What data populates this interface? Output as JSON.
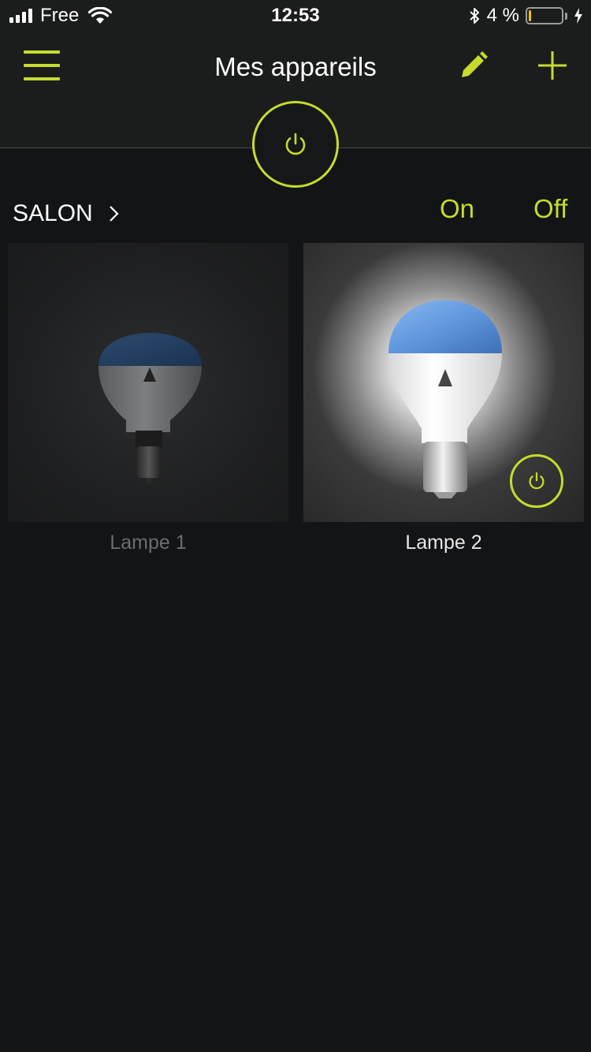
{
  "status_bar": {
    "carrier": "Free",
    "time": "12:53",
    "battery_percent": "4 %",
    "battery_level": 0.04,
    "signal_bars": 4
  },
  "header": {
    "title": "Mes appareils"
  },
  "section": {
    "name": "SALON",
    "on_label": "On",
    "off_label": "Off"
  },
  "devices": [
    {
      "name": "Lampe 1",
      "state": "off"
    },
    {
      "name": "Lampe 2",
      "state": "on"
    }
  ],
  "colors": {
    "accent": "#c6db2e",
    "background": "#131416",
    "header_bg": "#1b1c1c",
    "label_off": "#6c6d6e",
    "label_on": "#e6e6e6",
    "battery_fill": "#f5c400"
  },
  "icons": {
    "menu": "hamburger-icon",
    "edit": "pencil-icon",
    "add": "plus-icon",
    "power": "power-icon",
    "chevron": "chevron-right-icon"
  }
}
